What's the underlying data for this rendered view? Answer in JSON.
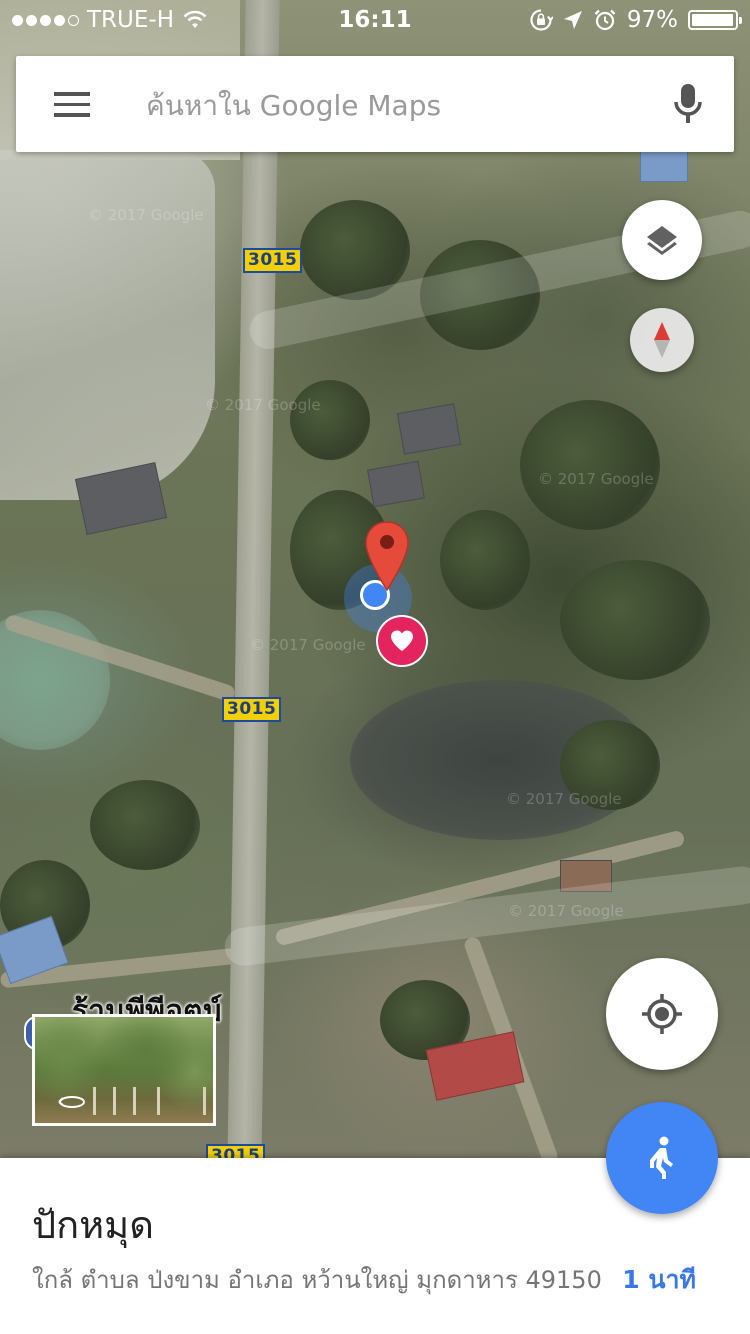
{
  "status_bar": {
    "carrier": "TRUE-H",
    "time": "16:11",
    "battery_percent": "97%",
    "battery_level": 0.97
  },
  "search": {
    "placeholder": "ค้นหาใน Google Maps",
    "menu_icon": "hamburger-menu-icon",
    "mic_icon": "microphone-icon"
  },
  "map": {
    "route_shields": [
      "3015",
      "3015",
      "3015"
    ],
    "watermark": "© 2017 Google",
    "place_label": "ร้านพีพีอุตม์"
  },
  "controls": {
    "layers_icon": "layers-icon",
    "compass_icon": "compass-icon",
    "my_location_icon": "my-location-icon",
    "walk_icon": "walking-person-icon",
    "accent_color": "#4285f4",
    "pin_color": "#e64a3b",
    "favorite_color": "#e3245e"
  },
  "place_sheet": {
    "title": "ปักหมุด",
    "address": "ใกล้ ตำบล ป่งขาม อำเภอ หว้านใหญ่ มุกดาหาร 49150",
    "eta": "1 นาที"
  }
}
